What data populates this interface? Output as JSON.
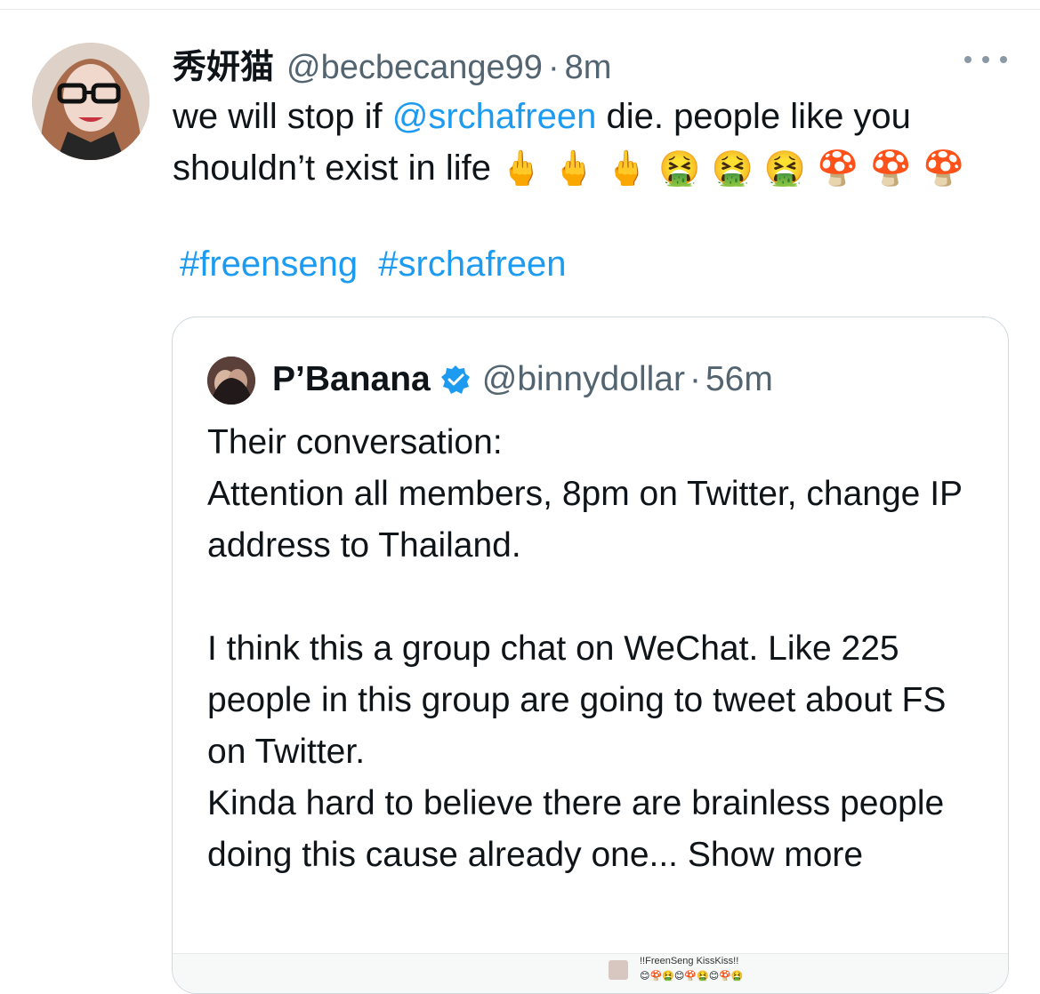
{
  "tweet": {
    "display_name": "秀妍猫",
    "handle": "@becbecange99",
    "separator": "·",
    "time": "8m",
    "text_before": "we will stop if ",
    "mention": "@srchafreen",
    "text_after": " die. people like you shouldn’t exist in life",
    "emojis": "🖕 🖕 🖕 🤮 🤮 🤮 🍄 🍄 🍄",
    "hashtags": [
      "#freenseng",
      "#srchafreen"
    ]
  },
  "quote": {
    "display_name": "P’Banana",
    "handle": "@binnydollar",
    "separator": "·",
    "time": "56m",
    "text": "Their conversation:\nAttention all members, 8pm on Twitter, change IP address to Thailand.\n\nI think this a group chat on WeChat. Like 225 people in this group are going to tweet about FS on Twitter.\nKinda hard to believe there are brainless people doing this cause already one...",
    "show_more": " Show more",
    "media_caption": "!!FreenSeng KissKiss!!",
    "media_icons": "😊🍄🤮😊🍄🤮😊🍄🤮"
  },
  "colors": {
    "link": "#1d9bf0",
    "secondary_text": "#536471",
    "border": "#cfd9de"
  }
}
